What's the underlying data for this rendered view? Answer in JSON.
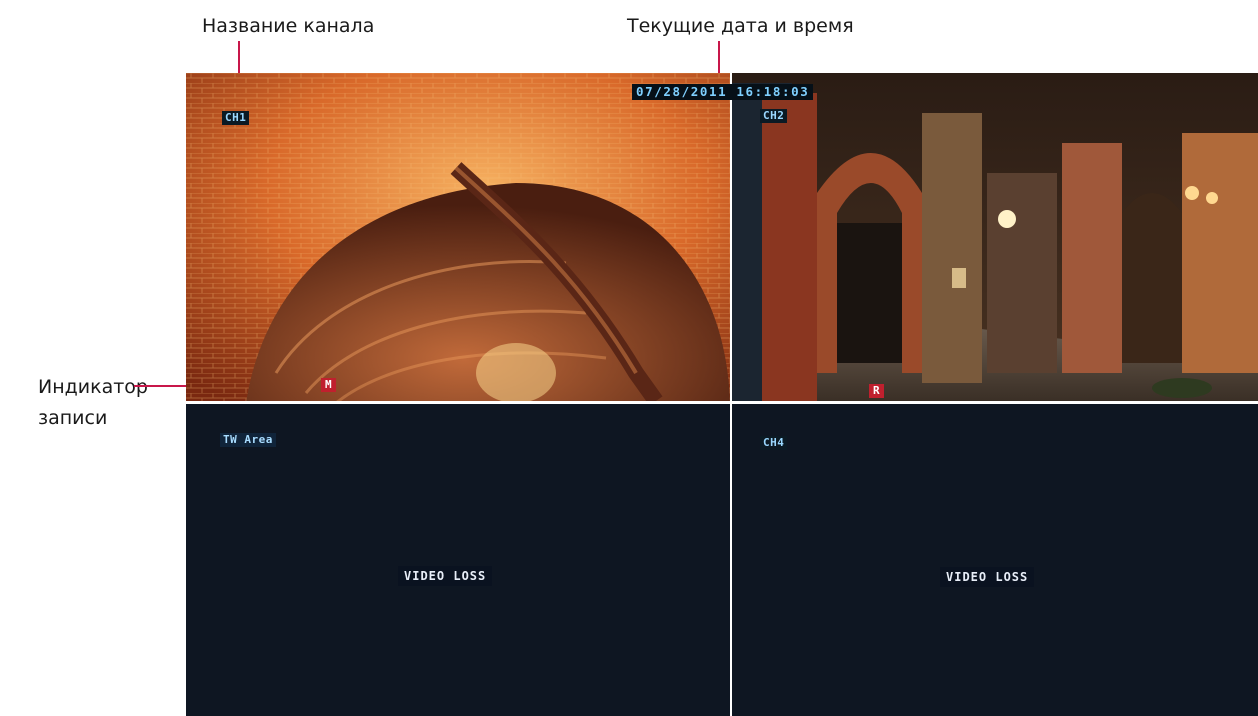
{
  "callouts": {
    "channel_name": "Название канала",
    "datetime": "Текущие дата и время",
    "record_indicator_line1": "Индикатор",
    "record_indicator_line2": "записи"
  },
  "osd": {
    "datetime": "07/28/2011 16:18:03"
  },
  "channels": [
    {
      "title": "CH1",
      "record_flag": "M",
      "status": ""
    },
    {
      "title": "CH2",
      "record_flag": "R",
      "status": ""
    },
    {
      "title": "TW Area",
      "record_flag": "",
      "status": "VIDEO LOSS"
    },
    {
      "title": "CH4",
      "record_flag": "",
      "status": "VIDEO LOSS"
    }
  ],
  "colors": {
    "leader_line": "#c8174a",
    "record_flag_bg": "#c0202e",
    "video_loss_bg": "#0e1622"
  }
}
